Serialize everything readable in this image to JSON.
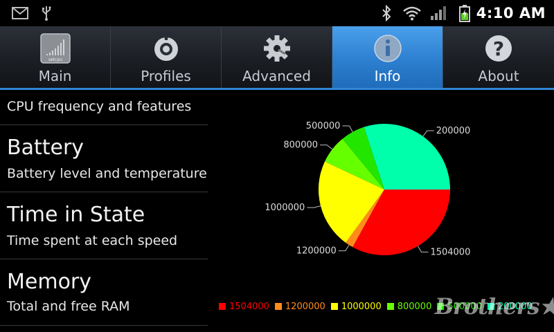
{
  "status_bar": {
    "time": "4:10 AM",
    "icons": [
      "gmail-icon",
      "usb-icon",
      "bluetooth-icon",
      "wifi-icon",
      "signal-icon",
      "battery-charging-icon"
    ]
  },
  "tabs": [
    {
      "label": "Main",
      "icon": "setcpu-logo-icon",
      "active": false
    },
    {
      "label": "Profiles",
      "icon": "profiles-icon",
      "active": false
    },
    {
      "label": "Advanced",
      "icon": "gear-icon",
      "active": false
    },
    {
      "label": "Info",
      "icon": "info-icon",
      "active": true
    },
    {
      "label": "About",
      "icon": "help-icon",
      "active": false
    }
  ],
  "setcpu_logo_text": "setcpu",
  "list": {
    "top_partial": "CPU frequency and features",
    "items": [
      {
        "title": "Battery",
        "subtitle": "Battery level and temperature"
      },
      {
        "title": "Time in State",
        "subtitle": "Time spent at each speed"
      },
      {
        "title": "Memory",
        "subtitle": "Total and free RAM"
      }
    ]
  },
  "chart_data": {
    "type": "pie",
    "labels": [
      "1504000",
      "1200000",
      "1000000",
      "800000",
      "500000",
      "200000"
    ],
    "values": [
      33,
      2,
      22,
      7,
      6,
      30
    ],
    "colors": [
      "#ff0000",
      "#ff8c1a",
      "#ffff00",
      "#66ff00",
      "#22e600",
      "#00ffaa"
    ],
    "legend_placement": "bottom"
  },
  "watermark": "Brothers★ft"
}
